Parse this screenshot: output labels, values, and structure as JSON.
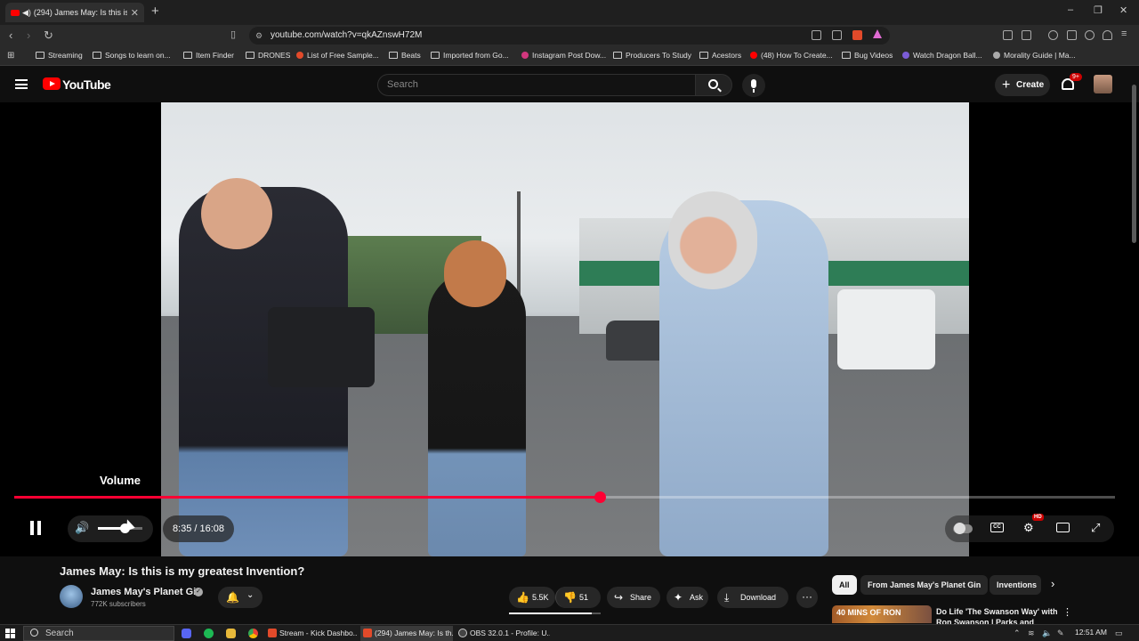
{
  "browser": {
    "tab_title": "(294) James May: Is this is my",
    "new_tab": "+",
    "url": "youtube.com/watch?v=qkAZnswH72M",
    "window_controls": [
      "–",
      "❐",
      "✕"
    ]
  },
  "bookmarks": [
    {
      "label": "Streaming",
      "icon": "folder-icon"
    },
    {
      "label": "Songs to learn on...",
      "icon": "folder-icon"
    },
    {
      "label": "Item Finder",
      "icon": "folder-icon"
    },
    {
      "label": "DRONES",
      "icon": "folder-icon"
    },
    {
      "label": "List of Free Sample...",
      "icon": "site-icon"
    },
    {
      "label": "Beats",
      "icon": "folder-icon"
    },
    {
      "label": "Imported from Go...",
      "icon": "folder-icon"
    },
    {
      "label": "Instagram Post Dow...",
      "icon": "site-icon"
    },
    {
      "label": "Producers To Study",
      "icon": "folder-icon"
    },
    {
      "label": "Acestors",
      "icon": "folder-icon"
    },
    {
      "label": "(48) How To Create...",
      "icon": "youtube-icon"
    },
    {
      "label": "Bug Videos",
      "icon": "folder-icon"
    },
    {
      "label": "Watch Dragon Ball...",
      "icon": "site-icon"
    },
    {
      "label": "Morality Guide | Ma...",
      "icon": "site-icon"
    }
  ],
  "youtube": {
    "logo_text": "YouTube",
    "search_placeholder": "Search",
    "create_label": "Create",
    "notification_count": "9+"
  },
  "player": {
    "volume_tooltip": "Volume",
    "time_display": "8:35 / 16:08",
    "progress_fraction": 0.532,
    "volume_fraction": 0.6,
    "hd_badge": "HD",
    "cc_label": "CC"
  },
  "video": {
    "title": "James May: Is this is my greatest Invention?",
    "channel_name": "James May's Planet Gin",
    "verified_mark": "✓",
    "subscribers": "772K subscribers",
    "likes": "5.5K",
    "dislikes": "51",
    "share_label": "Share",
    "ask_label": "Ask",
    "download_label": "Download",
    "more_label": "···"
  },
  "recommendations": {
    "chips": [
      "All",
      "From James May's Planet Gin",
      "Inventions"
    ],
    "first_video": {
      "thumb_text": "40 MINS OF RON",
      "title": "Do Life 'The Swanson Way' with Ron Swanson | Parks and"
    }
  },
  "taskbar": {
    "search_placeholder": "Search",
    "windows": [
      "Stream - Kick Dashbo...",
      "(294) James May: Is th...",
      "OBS 32.0.1 - Profile: U..."
    ],
    "clock": "12:51 AM"
  },
  "colors": {
    "youtube_red": "#ff0000",
    "progress_red": "#ff0033",
    "background": "#0f0f0f"
  }
}
